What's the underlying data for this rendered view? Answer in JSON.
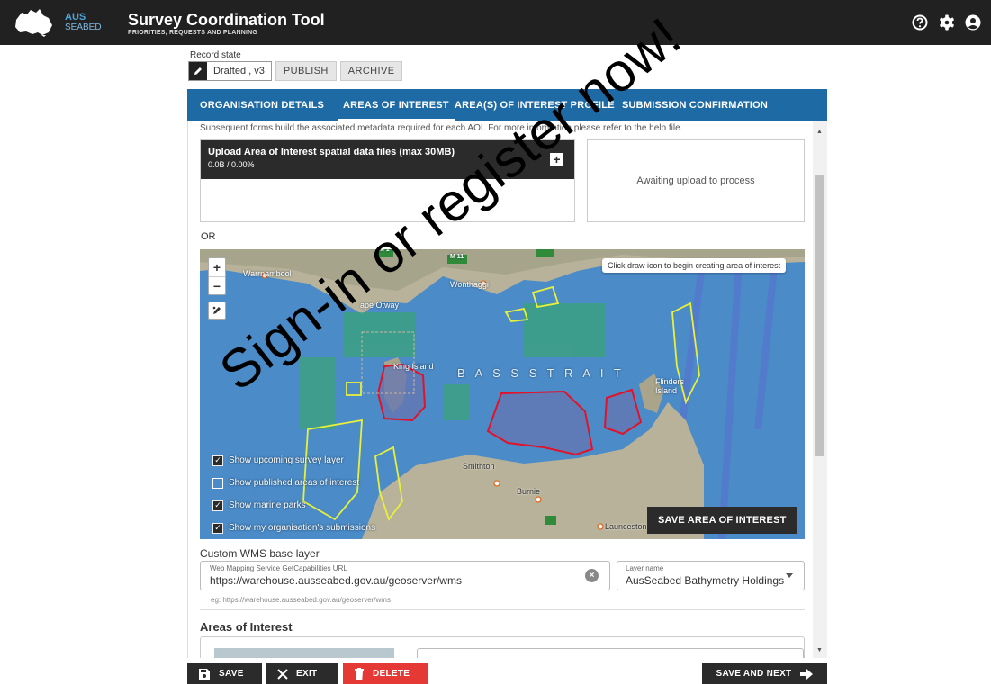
{
  "header": {
    "logo_text_top": "AUS",
    "logo_text_bottom": "SEABED",
    "title": "Survey Coordination Tool",
    "subtitle": "PRIORITIES, REQUESTS AND PLANNING"
  },
  "record_state": {
    "label": "Record state",
    "current": "Drafted , v3",
    "publish": "PUBLISH",
    "archive": "ARCHIVE"
  },
  "tabs": [
    {
      "label": "ORGANISATION DETAILS",
      "active": false
    },
    {
      "label": "AREAS OF INTEREST",
      "active": true
    },
    {
      "label": "AREA(S) OF INTEREST PROFILE",
      "active": false
    },
    {
      "label": "SUBMISSION CONFIRMATION",
      "active": false
    }
  ],
  "intro_text": "Subsequent forms build the associated metadata required for each AOI. For more information please refer to the help file.",
  "upload": {
    "title": "Upload Area of Interest spatial data files (max 30MB)",
    "progress": "0.0B / 0.00%",
    "status": "Awaiting upload to process"
  },
  "or_label": "OR",
  "map": {
    "tooltip": "Click draw icon to begin creating area of interest",
    "zoom_in": "+",
    "zoom_out": "−",
    "places": {
      "warrnambool": "Warrnambool",
      "wonthaggi": "Wonthaggi",
      "cape_otway": "ape Otway",
      "king_island": "King Island",
      "bass_strait": "B A S S   S T R A I T",
      "flinders": "Flinders Island",
      "smithton": "Smithton",
      "burnie": "Burnie",
      "launceston": "Launceston",
      "road_m1": "M 1",
      "road_m11": "M 11"
    },
    "layers": [
      {
        "label": "Show upcoming survey layer",
        "checked": true
      },
      {
        "label": "Show published areas of interest",
        "checked": false
      },
      {
        "label": "Show marine parks",
        "checked": true
      },
      {
        "label": "Show my organisation's submissions",
        "checked": true
      }
    ],
    "save_button": "SAVE AREA OF INTEREST"
  },
  "wms": {
    "title": "Custom WMS base layer",
    "url_label": "Web Mapping Service GetCapabilities URL",
    "url_value": "https://warehouse.ausseabed.gov.au/geoserver/wms",
    "layer_label": "Layer name",
    "layer_value": "AusSeabed Bathymetry Holdings",
    "example": "eg: https://warehouse.ausseabed.gov.au/geoserver/wms"
  },
  "aoi_section_title": "Areas of Interest",
  "footer": {
    "save": "SAVE",
    "exit": "EXIT",
    "delete": "DELETE",
    "save_next": "SAVE AND NEXT"
  },
  "watermark": "Sign-in or register now!",
  "colors": {
    "header_bg": "#212121",
    "tab_bg": "#1d6aa5",
    "delete_red": "#e53935",
    "aoi_red": "#e0132a",
    "survey_yellow": "#e8f03c"
  }
}
